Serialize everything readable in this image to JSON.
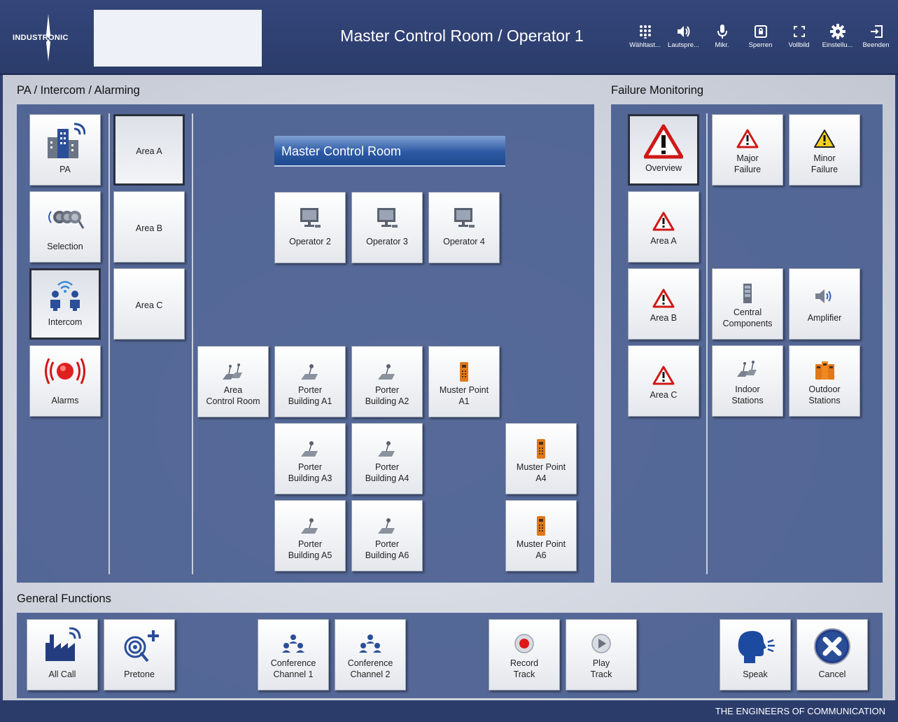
{
  "header": {
    "logo_text": "INDUSTRONIC",
    "title": "Master Control Room / Operator 1",
    "toolbar": [
      {
        "label": "Wähltast...",
        "icon": "dialpad-icon"
      },
      {
        "label": "Lautspre...",
        "icon": "speaker-icon"
      },
      {
        "label": "Mikr.",
        "icon": "microphone-icon"
      },
      {
        "label": "Sperren",
        "icon": "lock-icon"
      },
      {
        "label": "Vollbild",
        "icon": "fullscreen-icon"
      },
      {
        "label": "Einstellu...",
        "icon": "gear-icon"
      },
      {
        "label": "Beenden",
        "icon": "exit-icon"
      }
    ]
  },
  "pa": {
    "section_title": "PA / Intercom / Alarming",
    "modes": [
      {
        "label": "PA",
        "icon": "building-signal-icon"
      },
      {
        "label": "Selection",
        "icon": "selection-icon"
      },
      {
        "label": "Intercom",
        "icon": "intercom-people-icon"
      },
      {
        "label": "Alarms",
        "icon": "alarm-icon"
      }
    ],
    "areas": [
      "Area A",
      "Area B",
      "Area C"
    ],
    "group_header": "Master Control Room",
    "operators": [
      "Operator 2",
      "Operator 3",
      "Operator 4"
    ],
    "stations": {
      "area_control_room": "Area\nControl Room",
      "porter_a1": "Porter\nBuilding A1",
      "porter_a2": "Porter\nBuilding A2",
      "muster_a1": "Muster Point\nA1",
      "porter_a3": "Porter\nBuilding A3",
      "porter_a4": "Porter\nBuilding A4",
      "muster_a4": "Muster Point\nA4",
      "porter_a5": "Porter\nBuilding A5",
      "porter_a6": "Porter\nBuilding A6",
      "muster_a6": "Muster Point\nA6"
    }
  },
  "failure": {
    "section_title": "Failure Monitoring",
    "overview": "Overview",
    "major": "Major\nFailure",
    "minor": "Minor\nFailure",
    "area_a": "Area A",
    "area_b": "Area B",
    "area_c": "Area C",
    "central": "Central\nComponents",
    "amplifier": "Amplifier",
    "indoor": "Indoor\nStations",
    "outdoor": "Outdoor\nStations"
  },
  "general": {
    "section_title": "General Functions",
    "all_call": "All Call",
    "pretone": "Pretone",
    "conf1": "Conference\nChannel 1",
    "conf2": "Conference\nChannel 2",
    "record": "Record\nTrack",
    "play": "Play\nTrack",
    "speak": "Speak",
    "cancel": "Cancel"
  },
  "footer": {
    "tagline": "THE ENGINEERS OF COMMUNICATION"
  },
  "colors": {
    "header_bg": "#2e3f70",
    "panel_bg": "#42588c",
    "accent_blue": "#1f4a8f",
    "alarm_red": "#e02020",
    "warning_yellow": "#f5d020"
  }
}
